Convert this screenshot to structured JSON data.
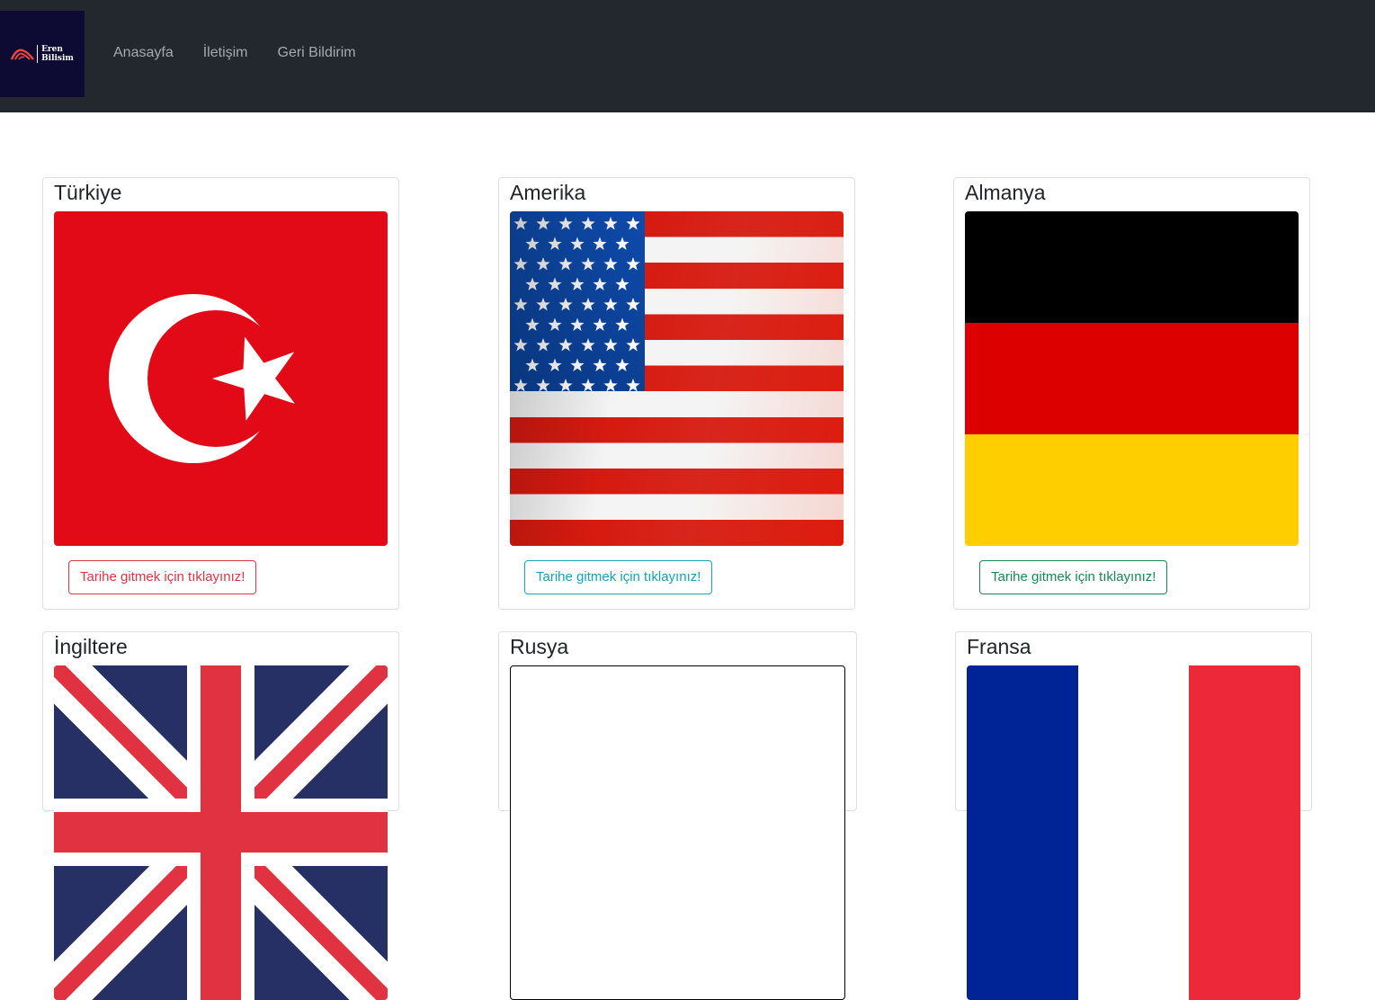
{
  "brand": {
    "logo_line1": "Eren",
    "logo_line2": "Bilisim"
  },
  "nav": {
    "items": [
      {
        "label": "Anasayfa"
      },
      {
        "label": "İletişim"
      },
      {
        "label": "Geri Bildirim"
      }
    ]
  },
  "cards": [
    {
      "title": "Türkiye",
      "button_label": "Tarihe gitmek için tıklayınız!",
      "flag": "turkey-flag",
      "button_color": "#dc3545"
    },
    {
      "title": "Amerika",
      "button_label": "Tarihe gitmek için tıklayınız!",
      "flag": "usa-flag",
      "button_color": "#17a2b8"
    },
    {
      "title": "Almanya",
      "button_label": "Tarihe gitmek için tıklayınız!",
      "flag": "germany-flag",
      "button_color": "#198754"
    },
    {
      "title": "İngiltere",
      "flag": "uk-flag"
    },
    {
      "title": "Rusya",
      "flag": "russia-flag"
    },
    {
      "title": "Fransa",
      "flag": "france-flag"
    }
  ],
  "colors": {
    "navbar_bg": "#23272e",
    "logo_bg": "#0d0a34",
    "nav_text": "#a6a9ad"
  }
}
